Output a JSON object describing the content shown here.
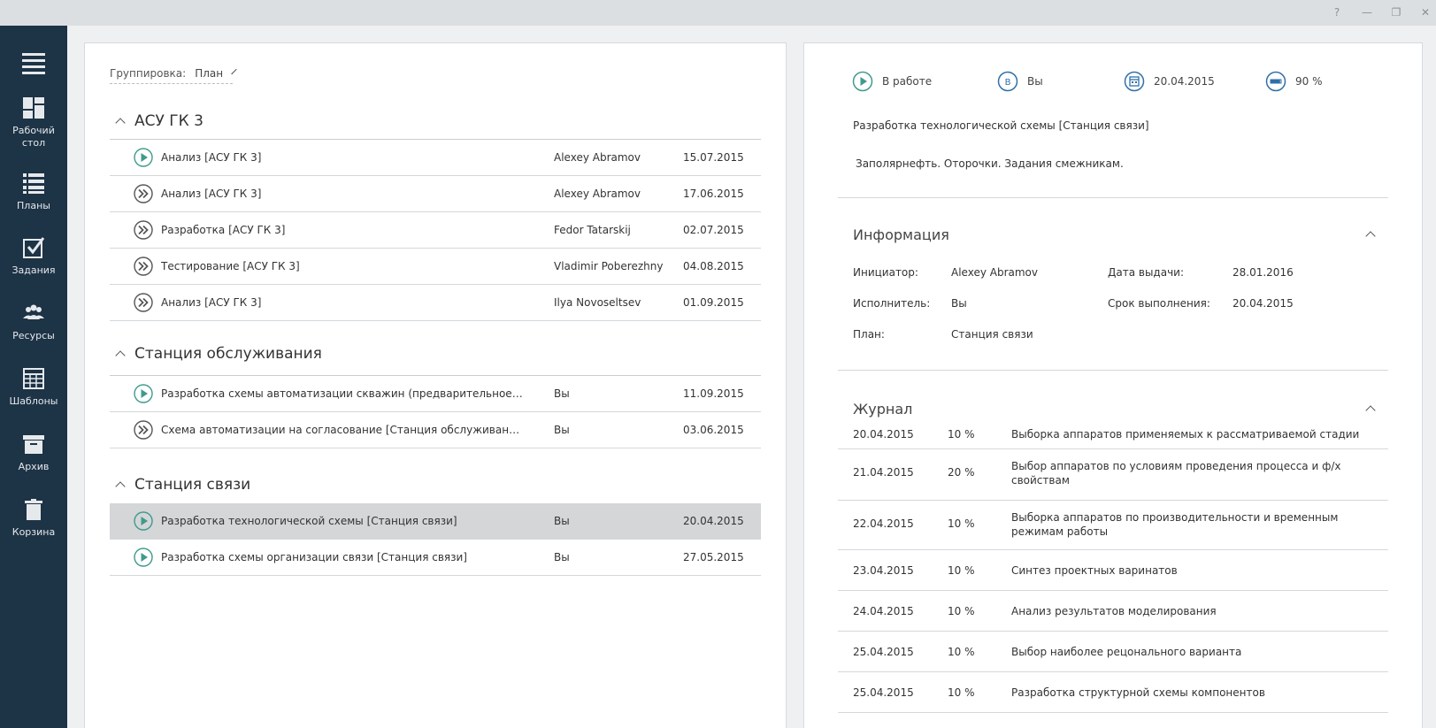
{
  "window": {
    "help": "?",
    "minimize": "—",
    "maximize": "❐",
    "close": "✕"
  },
  "sidebar": {
    "items": [
      {
        "label": "Рабочий стол",
        "icon": "dashboard-icon"
      },
      {
        "label": "Планы",
        "icon": "list-icon"
      },
      {
        "label": "Задания",
        "icon": "task-check-icon"
      },
      {
        "label": "Ресурсы",
        "icon": "people-icon"
      },
      {
        "label": "Шаблоны",
        "icon": "table-icon"
      },
      {
        "label": "Архив",
        "icon": "archive-icon"
      },
      {
        "label": "Корзина",
        "icon": "trash-icon"
      }
    ]
  },
  "grouping": {
    "label": "Группировка:",
    "value": "План"
  },
  "groups": [
    {
      "title": "АСУ ГК 3",
      "tasks": [
        {
          "icon": "play",
          "name": "Анализ [АСУ ГК 3]",
          "user": "Alexey Abramov",
          "date": "15.07.2015"
        },
        {
          "icon": "forward",
          "name": "Анализ [АСУ ГК 3]",
          "user": "Alexey Abramov",
          "date": "17.06.2015"
        },
        {
          "icon": "forward",
          "name": "Разработка [АСУ ГК 3]",
          "user": "Fedor Tatarskij",
          "date": "02.07.2015"
        },
        {
          "icon": "forward",
          "name": "Тестирование [АСУ ГК 3]",
          "user": "Vladimir Poberezhny",
          "date": "04.08.2015"
        },
        {
          "icon": "forward",
          "name": "Анализ [АСУ ГК 3]",
          "user": "Ilya Novoseltsev",
          "date": "01.09.2015"
        }
      ]
    },
    {
      "title": "Станция обслуживания",
      "tasks": [
        {
          "icon": "play",
          "name": "Разработка схемы автоматизации   скважин (предварительное задание...",
          "user": "Вы",
          "date": "11.09.2015"
        },
        {
          "icon": "forward",
          "name": "Схема автоматизации на согласование [Станция обслуживания]",
          "user": "Вы",
          "date": "03.06.2015"
        }
      ]
    },
    {
      "title": "Станция связи",
      "tasks": [
        {
          "icon": "play",
          "name": "Разработка технологической схемы [Станция связи]",
          "user": "Вы",
          "date": "20.04.2015",
          "selected": true
        },
        {
          "icon": "play",
          "name": "Разработка схемы организации связи [Станция связи]",
          "user": "Вы",
          "date": "27.05.2015"
        }
      ]
    }
  ],
  "detail": {
    "status": "В работе",
    "assignee": "Вы",
    "assignee_badge": "В",
    "due": "20.04.2015",
    "progress": "90 %",
    "progress_value": 0.9,
    "title": "Разработка технологической схемы [Станция связи]",
    "description": "Заполярнефть. Оторочки. Задания смежникам.",
    "info": {
      "heading": "Информация",
      "initiator_label": "Инициатор:",
      "initiator": "Alexey Abramov",
      "executor_label": "Исполнитель:",
      "executor": "Вы",
      "plan_label": "План:",
      "plan": "Станция связи",
      "issued_label": "Дата выдачи:",
      "issued": "28.01.2016",
      "deadline_label": "Срок выполнения:",
      "deadline": "20.04.2015"
    },
    "journal": {
      "heading": "Журнал",
      "rows": [
        {
          "date": "20.04.2015",
          "pct": "10 %",
          "text": "Выборка аппаратов применяемых к рассматриваемой стадии"
        },
        {
          "date": "21.04.2015",
          "pct": "20 %",
          "text": "Выбор аппаратов по условиям проведения процесса и ф/х свойствам"
        },
        {
          "date": "22.04.2015",
          "pct": "10 %",
          "text": "Выборка аппаратов по производительности и временным режимам работы"
        },
        {
          "date": "23.04.2015",
          "pct": "10 %",
          "text": "Синтез проектных варинатов"
        },
        {
          "date": "24.04.2015",
          "pct": "10 %",
          "text": "Анализ результатов моделирования"
        },
        {
          "date": "25.04.2015",
          "pct": "10 %",
          "text": "Выбор наиболее рецонального варианта"
        },
        {
          "date": "25.04.2015",
          "pct": "10 %",
          "text": "Разработка структурной схемы компонентов"
        }
      ]
    }
  },
  "colors": {
    "sidebar": "#1d3346",
    "accent": "#3f9a8e",
    "icon_blue": "#2f6fa8",
    "selected_row": "#d4d6d8"
  }
}
